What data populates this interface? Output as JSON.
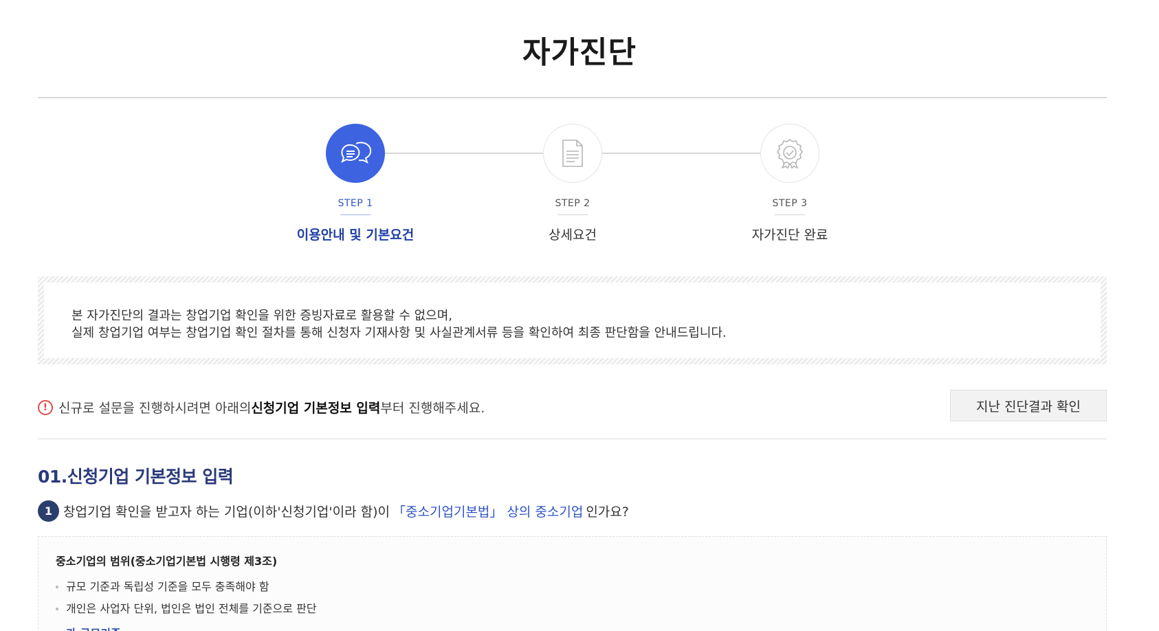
{
  "page": {
    "title": "자가진단"
  },
  "steps": [
    {
      "number": "STEP 1",
      "name": "이용안내 및 기본요건",
      "icon": "chat-bubbles-icon",
      "active": true
    },
    {
      "number": "STEP 2",
      "name": "상세요건",
      "icon": "document-icon",
      "active": false
    },
    {
      "number": "STEP 3",
      "name": "자가진단 완료",
      "icon": "certificate-badge-icon",
      "active": false
    }
  ],
  "notice": {
    "line1": "본 자가진단의 결과는 창업기업 확인을 위한 증빙자료로 활용할 수 없으며,",
    "line2": "실제 창업기업 여부는 창업기업 확인 절차를 통해 신청자 기재사항 및 사실관계서류 등을 확인하여 최종 판단함을 안내드립니다."
  },
  "info": {
    "icon": "alert-icon",
    "icon_symbol": "!",
    "prefix": "신규로 설문을 진행하시려면 아래의 ",
    "highlight": "신청기업 기본정보 입력",
    "suffix": "부터 진행해주세요.",
    "history_button": "지난 진단결과 확인"
  },
  "section": {
    "title": "01.신청기업 기본정보 입력",
    "question": {
      "number": "1",
      "text_before": "창업기업 확인을 받고자 하는 기업(이하'신청기업'이라 함)이 ",
      "link": "「중소기업기본법」 상의 중소기업",
      "text_after": "인가요?"
    },
    "scope": {
      "title": "중소기업의 범위(중소기업기본법 시행령 제3조)",
      "items": [
        "규모 기준과 독립성 기준을 모두 충족해야 함",
        "개인은 사업자 단위, 법인은 법인 전체를 기준으로 판단"
      ],
      "subheading": "가.규모기준"
    }
  },
  "colors": {
    "accent": "#3d63e0",
    "heading_navy": "#2a3a7a",
    "link_blue": "#2f55c8",
    "warning_red": "#e24b4b"
  }
}
